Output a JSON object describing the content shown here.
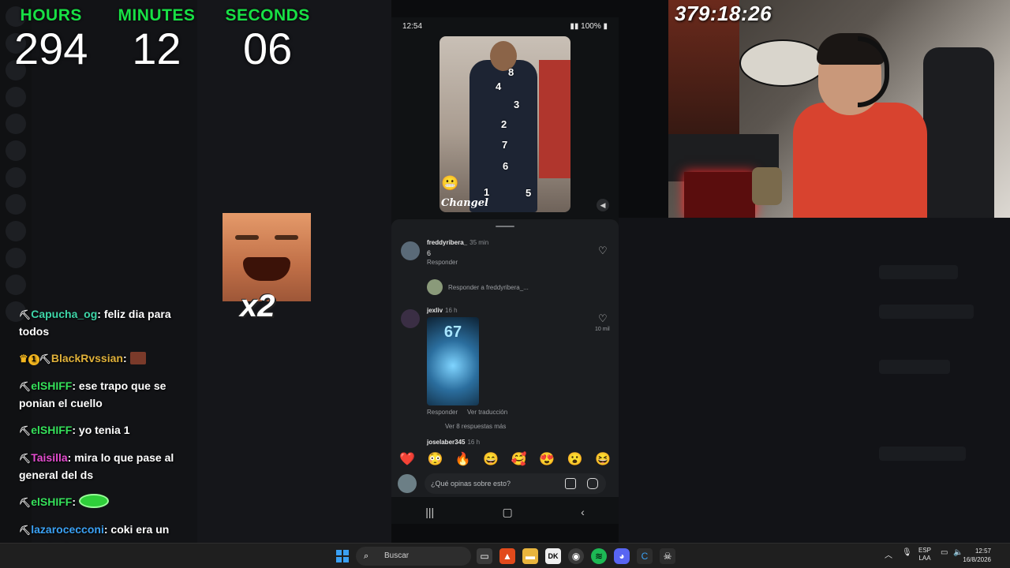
{
  "timer": {
    "hours_label": "HOURS",
    "hours": "294",
    "minutes_label": "MINUTES",
    "minutes": "12",
    "seconds_label": "SECONDS",
    "seconds": "06"
  },
  "cam_timer": "379:18:26",
  "overlay": {
    "multiplier": "x2"
  },
  "chat": [
    {
      "user": "Capucha_og",
      "color": "#3ed6a8",
      "text": "feliz dia para todos"
    },
    {
      "user": "BlackRvssian",
      "color": "#e0b13a",
      "text": "",
      "badge": "1"
    },
    {
      "user": "elSHIFF",
      "color": "#35e05a",
      "text": "ese trapo que se ponian el cuello"
    },
    {
      "user": "elSHIFF",
      "color": "#35e05a",
      "text": "yo tenia 1"
    },
    {
      "user": "Taisilla",
      "color": "#e44ccf",
      "text": "mira lo que pase al general del ds"
    },
    {
      "user": "elSHIFF",
      "color": "#35e05a",
      "text": ""
    },
    {
      "user": "lazarocecconi",
      "color": "#3aa0f3",
      "text": "coki era un gigachad"
    }
  ],
  "phone": {
    "time": "12:54",
    "battery": "100%",
    "video_numbers": [
      "8",
      "4",
      "3",
      "2",
      "7",
      "6",
      "1",
      "5"
    ],
    "watermark": "Changel",
    "comments": [
      {
        "user": "freddyribera_",
        "time": "35 min",
        "text": "6",
        "reply": "Responder"
      },
      {
        "user": "jexliv",
        "time": "16 h",
        "sticker": "67",
        "reply": "Responder",
        "translate": "Ver traducción",
        "likes": "10 mil"
      },
      {
        "user": "joselaber345",
        "time": "16 h"
      }
    ],
    "reply_to": "Responder a freddyribera_...",
    "more_replies": "Ver 8 respuestas más",
    "emojis": [
      "❤️",
      "😳",
      "🔥",
      "😄",
      "🥰",
      "😍",
      "😮",
      "😆"
    ],
    "composer_placeholder": "¿Qué opinas sobre esto?"
  },
  "taskbar": {
    "search": "Buscar",
    "lang1": "ESP",
    "lang2": "LAA",
    "time": "12:57",
    "date": "16/8/2026"
  },
  "colors": {
    "timer_label": "#18e045",
    "phone_bg": "#101214"
  }
}
